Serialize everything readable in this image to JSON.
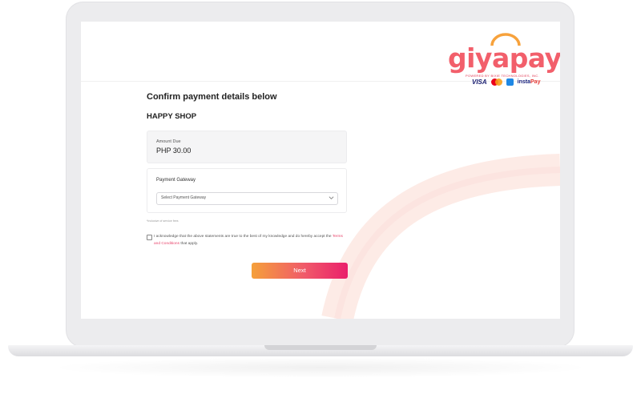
{
  "brand": {
    "logo_text": "giyapay",
    "tagline": "POWERED BY BIXIE TECHNOLOGIES, INC.",
    "payment_methods": {
      "visa": "VISA",
      "instapay_prefix": "insta",
      "instapay_suffix": "Pay"
    }
  },
  "page": {
    "title": "Confirm payment details below",
    "merchant": "HAPPY SHOP"
  },
  "amount": {
    "label": "Amount Due",
    "value": "PHP 30.00"
  },
  "gateway": {
    "label": "Payment Gateway",
    "placeholder": "Select Payment Gateway"
  },
  "note": "*Inclusive of service fees",
  "acknowledgement": {
    "text_before": "I acknowledge that the above statements are true to the best of my knowledge and do hereby accept the ",
    "link": "Terms and Conditions",
    "text_after": " that apply."
  },
  "next_button": "Next",
  "colors": {
    "accent_start": "#f5a03a",
    "accent_end": "#ea1f6b",
    "link": "#e8456c"
  }
}
